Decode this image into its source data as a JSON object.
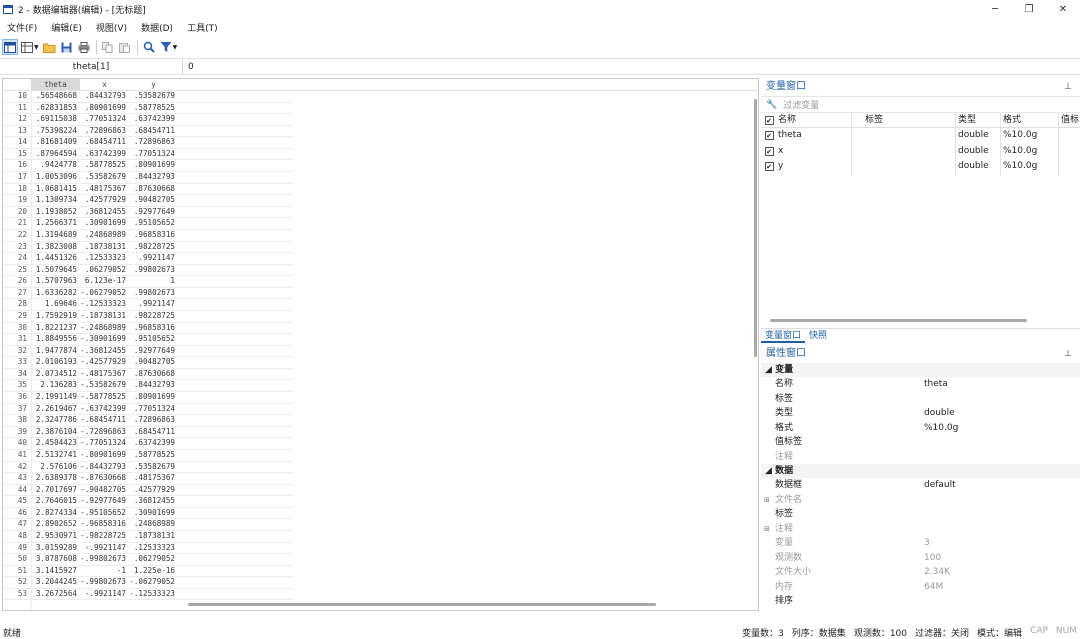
{
  "window": {
    "title": "2 - 数据编辑器(编辑) - [无标题]",
    "minimize": "─",
    "maximize": "❐",
    "close": "✕"
  },
  "menu": [
    "文件(F)",
    "编辑(E)",
    "视图(V)",
    "数据(D)",
    "工具(T)"
  ],
  "cellbar": {
    "ref": "theta[1]",
    "value": "0"
  },
  "grid": {
    "columns": [
      "theta",
      "x",
      "y"
    ],
    "rows": [
      [
        "10",
        ".56548668",
        ".84432793",
        ".53582679"
      ],
      [
        "11",
        ".62831853",
        ".80901699",
        ".58778525"
      ],
      [
        "12",
        ".69115038",
        ".77051324",
        ".63742399"
      ],
      [
        "13",
        ".75398224",
        ".72896863",
        ".68454711"
      ],
      [
        "14",
        ".81681409",
        ".68454711",
        ".72896863"
      ],
      [
        "15",
        ".87964594",
        ".63742399",
        ".77051324"
      ],
      [
        "16",
        ".9424778",
        ".58778525",
        ".80901699"
      ],
      [
        "17",
        "1.0053096",
        ".53582679",
        ".84432793"
      ],
      [
        "18",
        "1.0681415",
        ".48175367",
        ".87630668"
      ],
      [
        "19",
        "1.1309734",
        ".42577929",
        ".90482705"
      ],
      [
        "20",
        "1.1938052",
        ".36812455",
        ".92977649"
      ],
      [
        "21",
        "1.2566371",
        ".30901699",
        ".95105652"
      ],
      [
        "22",
        "1.3194689",
        ".24868989",
        ".96858316"
      ],
      [
        "23",
        "1.3823008",
        ".18738131",
        ".98228725"
      ],
      [
        "24",
        "1.4451326",
        ".12533323",
        ".9921147"
      ],
      [
        "25",
        "1.5079645",
        ".06279052",
        ".99802673"
      ],
      [
        "26",
        "1.5707963",
        "6.123e-17",
        "1"
      ],
      [
        "27",
        "1.6336282",
        "-.06279052",
        ".99802673"
      ],
      [
        "28",
        "1.69646",
        "-.12533323",
        ".9921147"
      ],
      [
        "29",
        "1.7592919",
        "-.18738131",
        ".98228725"
      ],
      [
        "30",
        "1.8221237",
        "-.24868989",
        ".96858316"
      ],
      [
        "31",
        "1.8849556",
        "-.30901699",
        ".95105652"
      ],
      [
        "32",
        "1.9477874",
        "-.36812455",
        ".92977649"
      ],
      [
        "33",
        "2.0106193",
        "-.42577929",
        ".90482705"
      ],
      [
        "34",
        "2.0734512",
        "-.48175367",
        ".87630668"
      ],
      [
        "35",
        "2.136283",
        "-.53582679",
        ".84432793"
      ],
      [
        "36",
        "2.1991149",
        "-.58778525",
        ".80901699"
      ],
      [
        "37",
        "2.2619467",
        "-.63742399",
        ".77051324"
      ],
      [
        "38",
        "2.3247786",
        "-.68454711",
        ".72896863"
      ],
      [
        "39",
        "2.3876104",
        "-.72896863",
        ".68454711"
      ],
      [
        "40",
        "2.4504423",
        "-.77051324",
        ".63742399"
      ],
      [
        "41",
        "2.5132741",
        "-.80901699",
        ".58778525"
      ],
      [
        "42",
        "2.576106",
        "-.84432793",
        ".53582679"
      ],
      [
        "43",
        "2.6389378",
        "-.87630668",
        ".48175367"
      ],
      [
        "44",
        "2.7017697",
        "-.90482705",
        ".42577929"
      ],
      [
        "45",
        "2.7646015",
        "-.92977649",
        ".36812455"
      ],
      [
        "46",
        "2.8274334",
        "-.95105652",
        ".30901699"
      ],
      [
        "47",
        "2.8902652",
        "-.96858316",
        ".24868989"
      ],
      [
        "48",
        "2.9530971",
        "-.98228725",
        ".18738131"
      ],
      [
        "49",
        "3.0159289",
        "-.9921147",
        ".12533323"
      ],
      [
        "50",
        "3.0787608",
        "-.99802673",
        ".06279052"
      ],
      [
        "51",
        "3.1415927",
        "-1",
        "1.225e-16"
      ],
      [
        "52",
        "3.2044245",
        "-.99802673",
        "-.06279052"
      ],
      [
        "53",
        "3.2672564",
        "-.9921147",
        "-.12533323"
      ]
    ]
  },
  "var_window": {
    "title": "变量窗口",
    "pin": "⊥",
    "filter_placeholder": "过滤变量",
    "headers": {
      "name": "名称",
      "label": "标签",
      "type": "类型",
      "format": "格式",
      "value_label": "值标"
    },
    "vars": [
      {
        "name": "theta",
        "type": "double",
        "format": "%10.0g"
      },
      {
        "name": "x",
        "type": "double",
        "format": "%10.0g"
      },
      {
        "name": "y",
        "type": "double",
        "format": "%10.0g"
      }
    ]
  },
  "tabs": [
    "变量窗口",
    "快照"
  ],
  "prop_window": {
    "title": "属性窗口",
    "pin": "⊥",
    "var_section": "变量",
    "var_props": [
      {
        "name": "名称",
        "value": "theta"
      },
      {
        "name": "标签",
        "value": ""
      },
      {
        "name": "类型",
        "value": "double"
      },
      {
        "name": "格式",
        "value": "%10.0g"
      },
      {
        "name": "值标签",
        "value": ""
      },
      {
        "name": "注释",
        "value": ""
      }
    ],
    "data_section": "数据",
    "data_props": [
      {
        "name": "数据框",
        "value": "default"
      },
      {
        "name": "文件名",
        "value": ""
      },
      {
        "name": "标签",
        "value": ""
      },
      {
        "name": "注释",
        "value": ""
      },
      {
        "name": "变量",
        "value": "3"
      },
      {
        "name": "观测数",
        "value": "100"
      },
      {
        "name": "文件大小",
        "value": "2.34K"
      },
      {
        "name": "内存",
        "value": "64M"
      },
      {
        "name": "排序",
        "value": ""
      }
    ]
  },
  "status": {
    "left": "就绪",
    "vars": "变量数：3",
    "order": "列序：数据集",
    "obs": "观测数：100",
    "filter": "过滤器：关闭",
    "mode": "模式：编辑",
    "cap": "CAP",
    "num": "NUM"
  }
}
